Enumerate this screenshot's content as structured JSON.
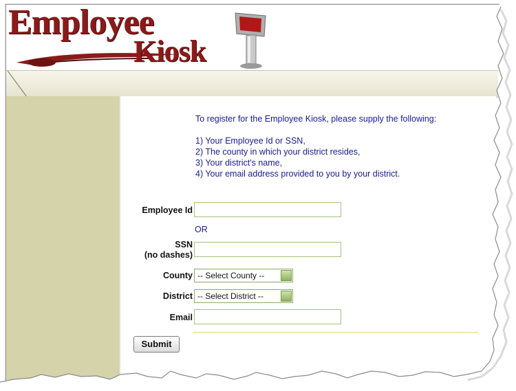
{
  "logo": {
    "line1": "Employee",
    "line2": "Kiosk"
  },
  "intro": {
    "heading": "To register for the Employee Kiosk, please supply the following:",
    "items": [
      "1) Your Employee Id or SSN,",
      "2) The county in which your district resides,",
      "3) Your district's name,",
      "4) Your email address provided to you by your district."
    ]
  },
  "form": {
    "employee_id_label": "Employee Id",
    "employee_id_value": "",
    "or_text": "OR",
    "ssn_label_line1": "SSN",
    "ssn_label_line2": "(no dashes)",
    "ssn_value": "",
    "county_label": "County",
    "county_selected": "-- Select County --",
    "district_label": "District",
    "district_selected": "-- Select District --",
    "email_label": "Email",
    "email_value": "",
    "submit_label": "Submit"
  },
  "colors": {
    "logo": "#8b1a1a",
    "intro_text": "#1a1a96",
    "sidebar": "#d4d3aa",
    "field_border": "#a6c27a"
  }
}
